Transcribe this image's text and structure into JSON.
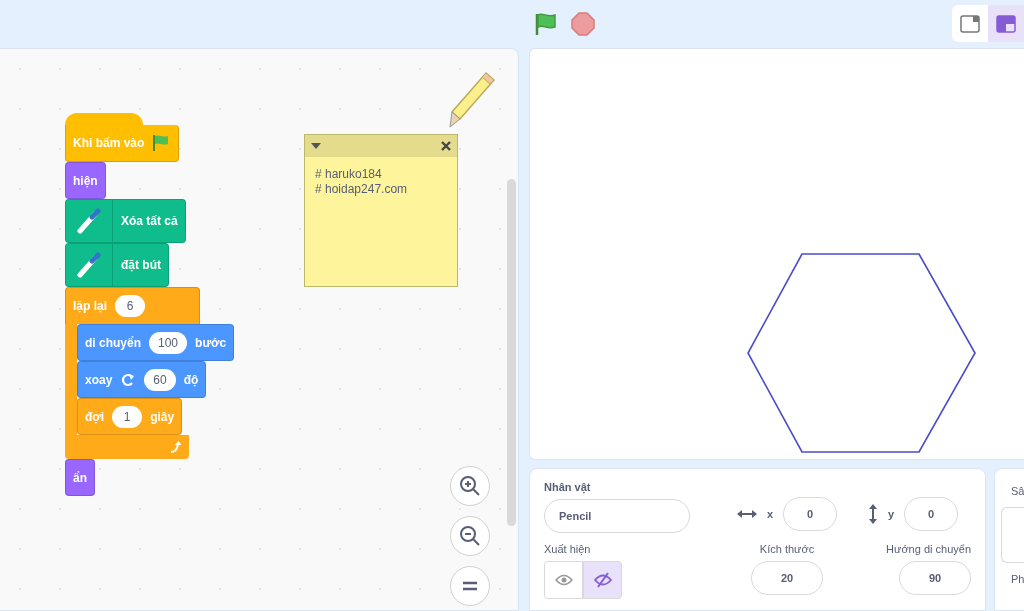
{
  "toolbar": {
    "view_modes": [
      {
        "selected": false
      },
      {
        "selected": true
      }
    ]
  },
  "script": {
    "blocks": [
      {
        "color": "#ffbf00",
        "kind": "hat",
        "parts": [
          {
            "kind": "label",
            "text": "Khi bấm vào"
          },
          {
            "kind": "flag"
          }
        ]
      },
      {
        "color": "#9966ff",
        "kind": "stack",
        "parts": [
          {
            "kind": "label",
            "text": "hiện"
          }
        ]
      },
      {
        "color": "#0fbd8c",
        "kind": "stack",
        "parts": [
          {
            "kind": "pen"
          },
          {
            "kind": "label",
            "text": "Xóa tất cả"
          }
        ]
      },
      {
        "color": "#0fbd8c",
        "kind": "stack",
        "parts": [
          {
            "kind": "pen"
          },
          {
            "kind": "label",
            "text": "đặt bút"
          }
        ]
      },
      {
        "color": "#ffab19",
        "kind": "c",
        "parts": [
          {
            "kind": "label",
            "text": "lặp lại"
          },
          {
            "kind": "input",
            "text": "6"
          }
        ],
        "children": [
          {
            "color": "#4c97ff",
            "parts": [
              {
                "kind": "label",
                "text": "di chuyển"
              },
              {
                "kind": "input",
                "text": "100"
              },
              {
                "kind": "label",
                "text": "bước"
              }
            ]
          },
          {
            "color": "#4c97ff",
            "parts": [
              {
                "kind": "label",
                "text": "xoay"
              },
              {
                "kind": "turn"
              },
              {
                "kind": "input",
                "text": "60"
              },
              {
                "kind": "label",
                "text": "độ"
              }
            ]
          },
          {
            "color": "#ffab19",
            "parts": [
              {
                "kind": "label",
                "text": "đợi"
              },
              {
                "kind": "input",
                "text": "1"
              },
              {
                "kind": "label",
                "text": "giây"
              }
            ]
          }
        ]
      },
      {
        "color": "#9966ff",
        "kind": "stack",
        "parts": [
          {
            "kind": "label",
            "text": "ẩn"
          }
        ]
      }
    ]
  },
  "comment": {
    "lines": [
      "# haruko184",
      "# hoidap247.com"
    ]
  },
  "sprite_info": {
    "sprite_label": "Nhân vật",
    "sprite_name": "Pencil",
    "x_label": "x",
    "x_value": "0",
    "y_label": "y",
    "y_value": "0",
    "show_label": "Xuất hiện",
    "show_options": [
      {
        "kind": "visible",
        "selected": false
      },
      {
        "kind": "hidden",
        "selected": true
      }
    ],
    "size_label": "Kích thước",
    "size_value": "20",
    "direction_label": "Hướng di chuyển",
    "direction_value": "90"
  },
  "stage_panel": {
    "title": "Sâ",
    "backdrops_label": "Ph"
  }
}
